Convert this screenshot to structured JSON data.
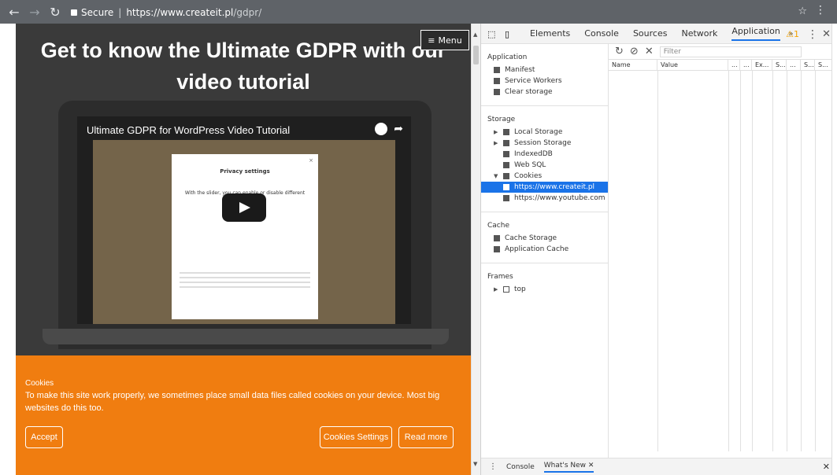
{
  "browser": {
    "secure_label": "Secure",
    "url_host": "https://www.createit.pl",
    "url_path": "/gdpr/"
  },
  "page": {
    "hero_title": "Get to know the Ultimate GDPR with our video tutorial",
    "menu_label": "Menu",
    "video_title": "Ultimate GDPR for WordPress Video Tutorial",
    "privacy_title": "Privacy settings",
    "privacy_slider_text": "With the slider, you can enable or disable different types of cookies:",
    "cookie": {
      "title": "Cookies",
      "text": "To make this site work properly, we sometimes place small data files called cookies on your device. Most big websites do this too.",
      "accept": "Accept",
      "settings": "Cookies Settings",
      "read_more": "Read more"
    }
  },
  "devtools": {
    "tabs": [
      "Elements",
      "Console",
      "Sources",
      "Network",
      "Application"
    ],
    "active_tab": "Application",
    "more": "»",
    "warning_count": "1",
    "sidebar": {
      "application_title": "Application",
      "application_items": [
        "Manifest",
        "Service Workers",
        "Clear storage"
      ],
      "storage_title": "Storage",
      "storage_items": [
        "Local Storage",
        "Session Storage",
        "IndexedDB",
        "Web SQL",
        "Cookies"
      ],
      "cookie_items": [
        "https://www.createit.pl",
        "https://www.youtube.com"
      ],
      "cache_title": "Cache",
      "cache_items": [
        "Cache Storage",
        "Application Cache"
      ],
      "frames_title": "Frames",
      "frames_items": [
        "top"
      ]
    },
    "toolbar": {
      "filter_placeholder": "Filter"
    },
    "columns": [
      "Name",
      "Value",
      "...",
      "...",
      "Ex...",
      "S...",
      "...",
      "S...",
      "S..."
    ],
    "drawer": {
      "tabs": [
        "Console",
        "What's New"
      ],
      "active": "What's New"
    }
  }
}
